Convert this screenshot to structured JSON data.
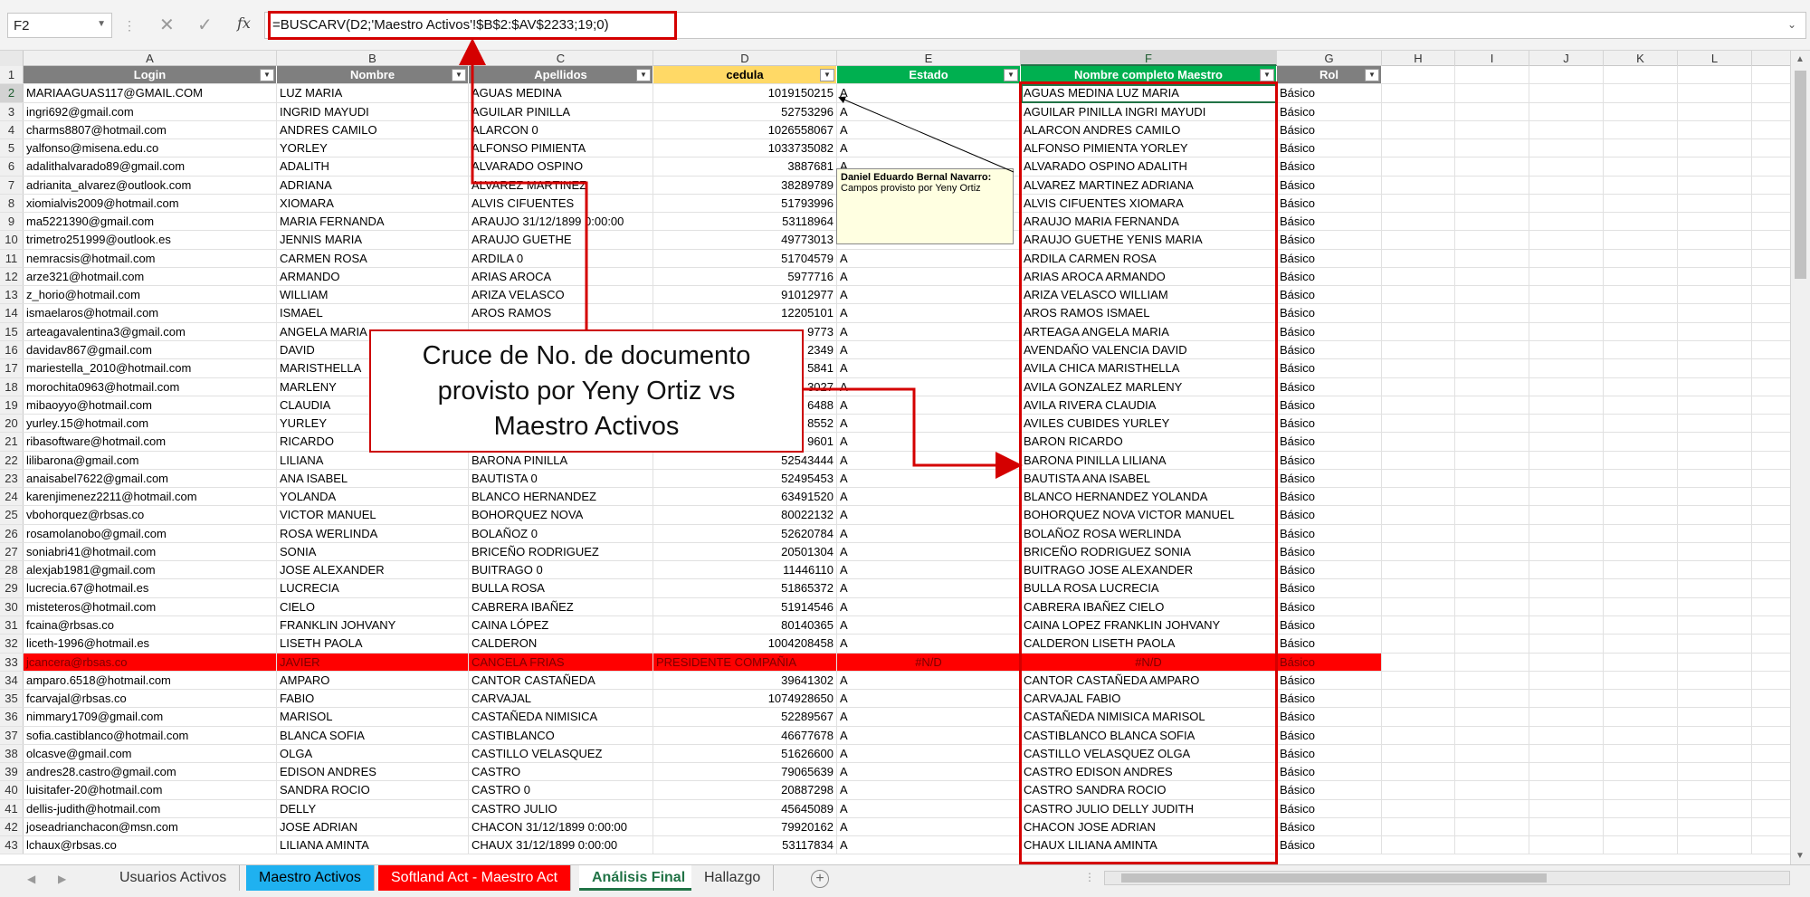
{
  "formula_bar": {
    "name_box": "F2",
    "formula": "=BUSCARV(D2;'Maestro Activos'!$B$2:$AV$2233;19;0)",
    "fx_label": "fx"
  },
  "columns": [
    "A",
    "B",
    "C",
    "D",
    "E",
    "F",
    "G",
    "H",
    "I",
    "J",
    "K",
    "L"
  ],
  "headers": {
    "login": "Login",
    "nombre": "Nombre",
    "apellidos": "Apellidos",
    "cedula": "cedula",
    "estado": "Estado",
    "nombre_completo": "Nombre completo Maestro",
    "rol": "Rol"
  },
  "rows": [
    {
      "n": "2",
      "login": "MARIAAGUAS117@GMAIL.COM",
      "nombre": "LUZ MARIA",
      "apellidos": "AGUAS MEDINA",
      "cedula": "1019150215",
      "estado": "A",
      "maestro": "AGUAS MEDINA LUZ  MARIA",
      "rol": "Básico"
    },
    {
      "n": "3",
      "login": "ingri692@gmail.com",
      "nombre": "INGRID MAYUDI",
      "apellidos": "AGUILAR PINILLA",
      "cedula": "52753296",
      "estado": "A",
      "maestro": "AGUILAR PINILLA INGRI  MAYUDI",
      "rol": "Básico"
    },
    {
      "n": "4",
      "login": "charms8807@hotmail.com",
      "nombre": "ANDRES CAMILO",
      "apellidos": "ALARCON 0",
      "cedula": "1026558067",
      "estado": "A",
      "maestro": "ALARCON  ANDRES CAMILO",
      "rol": "Básico"
    },
    {
      "n": "5",
      "login": "yalfonso@misena.edu.co",
      "nombre": "YORLEY",
      "apellidos": "ALFONSO PIMIENTA",
      "cedula": "1033735082",
      "estado": "A",
      "maestro": "ALFONSO PIMIENTA YORLEY",
      "rol": "Básico"
    },
    {
      "n": "6",
      "login": "adalithalvarado89@gmail.com",
      "nombre": "ADALITH",
      "apellidos": "ALVARADO OSPINO",
      "cedula": "3887681",
      "estado": "A",
      "maestro": "ALVARADO OSPINO ADALITH",
      "rol": "Básico"
    },
    {
      "n": "7",
      "login": "adrianita_alvarez@outlook.com",
      "nombre": "ADRIANA",
      "apellidos": "ALVAREZ MARTINEZ",
      "cedula": "38289789",
      "estado": "A",
      "maestro": "ALVAREZ MARTINEZ ADRIANA",
      "rol": "Básico"
    },
    {
      "n": "8",
      "login": "xiomialvis2009@hotmail.com",
      "nombre": "XIOMARA",
      "apellidos": "ALVIS CIFUENTES",
      "cedula": "51793996",
      "estado": "A",
      "maestro": "ALVIS CIFUENTES XIOMARA",
      "rol": "Básico"
    },
    {
      "n": "9",
      "login": "ma5221390@gmail.com",
      "nombre": "MARIA FERNANDA",
      "apellidos": "ARAUJO 31/12/1899 0:00:00",
      "cedula": "53118964",
      "estado": "A",
      "maestro": "ARAUJO   MARIA FERNANDA",
      "rol": "Básico"
    },
    {
      "n": "10",
      "login": "trimetro251999@outlook.es",
      "nombre": "JENNIS  MARIA",
      "apellidos": "ARAUJO GUETHE",
      "cedula": "49773013",
      "estado": "A",
      "maestro": "ARAUJO GUETHE YENIS  MARIA",
      "rol": "Básico"
    },
    {
      "n": "11",
      "login": "nemracsis@hotmail.com",
      "nombre": "CARMEN ROSA",
      "apellidos": "ARDILA 0",
      "cedula": "51704579",
      "estado": "A",
      "maestro": "ARDILA   CARMEN ROSA",
      "rol": "Básico"
    },
    {
      "n": "12",
      "login": "arze321@hotmail.com",
      "nombre": "ARMANDO",
      "apellidos": "ARIAS AROCA",
      "cedula": "5977716",
      "estado": "A",
      "maestro": "ARIAS AROCA ARMANDO",
      "rol": "Básico"
    },
    {
      "n": "13",
      "login": "z_horio@hotmail.com",
      "nombre": "WILLIAM",
      "apellidos": "ARIZA VELASCO",
      "cedula": "91012977",
      "estado": "A",
      "maestro": "ARIZA VELASCO WILLIAM",
      "rol": "Básico"
    },
    {
      "n": "14",
      "login": "ismaelaros@hotmail.com",
      "nombre": "ISMAEL",
      "apellidos": "AROS RAMOS",
      "cedula": "12205101",
      "estado": "A",
      "maestro": "AROS RAMOS ISMAEL",
      "rol": "Básico"
    },
    {
      "n": "15",
      "login": "arteagavalentina3@gmail.com",
      "nombre": "ANGELA MARIA",
      "apellidos": "",
      "cedula": "9773",
      "estado": "A",
      "maestro": "ARTEAGA   ANGELA MARIA",
      "rol": "Básico"
    },
    {
      "n": "16",
      "login": "davidav867@gmail.com",
      "nombre": "DAVID",
      "apellidos": "",
      "cedula": "2349",
      "estado": "A",
      "maestro": "AVENDAÑO VALENCIA DAVID",
      "rol": "Básico"
    },
    {
      "n": "17",
      "login": "mariestella_2010@hotmail.com",
      "nombre": "MARISTHELLA",
      "apellidos": "",
      "cedula": "5841",
      "estado": "A",
      "maestro": "AVILA CHICA MARISTHELLA",
      "rol": "Básico"
    },
    {
      "n": "18",
      "login": "morochita0963@hotmail.com",
      "nombre": "MARLENY",
      "apellidos": "",
      "cedula": "3027",
      "estado": "A",
      "maestro": "AVILA GONZALEZ MARLENY",
      "rol": "Básico"
    },
    {
      "n": "19",
      "login": "mibaoyyo@hotmail.com",
      "nombre": "CLAUDIA",
      "apellidos": "",
      "cedula": "6488",
      "estado": "A",
      "maestro": "AVILA RIVERA CLAUDIA",
      "rol": "Básico"
    },
    {
      "n": "20",
      "login": "yurley.15@hotmail.com",
      "nombre": "YURLEY",
      "apellidos": "",
      "cedula": "8552",
      "estado": "A",
      "maestro": "AVILES CUBIDES YURLEY",
      "rol": "Básico"
    },
    {
      "n": "21",
      "login": "ribasoftware@hotmail.com",
      "nombre": "RICARDO",
      "apellidos": "",
      "cedula": "9601",
      "estado": "A",
      "maestro": "BARON   RICARDO",
      "rol": "Básico"
    },
    {
      "n": "22",
      "login": "lilibarona@gmail.com",
      "nombre": "LILIANA",
      "apellidos": "BARONA PINILLA",
      "cedula": "52543444",
      "estado": "A",
      "maestro": "BARONA PINILLA LILIANA",
      "rol": "Básico"
    },
    {
      "n": "23",
      "login": "anaisabel7622@gmail.com",
      "nombre": "ANA ISABEL",
      "apellidos": "BAUTISTA 0",
      "cedula": "52495453",
      "estado": "A",
      "maestro": "BAUTISTA   ANA ISABEL",
      "rol": "Básico"
    },
    {
      "n": "24",
      "login": "karenjimenez2211@hotmail.com",
      "nombre": "YOLANDA",
      "apellidos": "BLANCO HERNANDEZ",
      "cedula": "63491520",
      "estado": "A",
      "maestro": "BLANCO HERNANDEZ YOLANDA",
      "rol": "Básico"
    },
    {
      "n": "25",
      "login": "vbohorquez@rbsas.co",
      "nombre": "VICTOR MANUEL",
      "apellidos": "BOHORQUEZ NOVA",
      "cedula": "80022132",
      "estado": "A",
      "maestro": "BOHORQUEZ NOVA VICTOR  MANUEL",
      "rol": "Básico"
    },
    {
      "n": "26",
      "login": "rosamolanobo@gmail.com",
      "nombre": "ROSA WERLINDA",
      "apellidos": "BOLAÑOZ 0",
      "cedula": "52620784",
      "estado": "A",
      "maestro": "BOLAÑOZ   ROSA WERLINDA",
      "rol": "Básico"
    },
    {
      "n": "27",
      "login": "soniabri41@hotmail.com",
      "nombre": "SONIA",
      "apellidos": "BRICEÑO RODRIGUEZ",
      "cedula": "20501304",
      "estado": "A",
      "maestro": "BRICEÑO RODRIGUEZ SONIA",
      "rol": "Básico"
    },
    {
      "n": "28",
      "login": "alexjab1981@gmail.com",
      "nombre": "JOSE ALEXANDER",
      "apellidos": "BUITRAGO 0",
      "cedula": "11446110",
      "estado": "A",
      "maestro": "BUITRAGO   JOSE ALEXANDER",
      "rol": "Básico"
    },
    {
      "n": "29",
      "login": "lucrecia.67@hotmail.es",
      "nombre": "LUCRECIA",
      "apellidos": "BULLA ROSA",
      "cedula": "51865372",
      "estado": "A",
      "maestro": "BULLA ROSA LUCRECIA",
      "rol": "Básico"
    },
    {
      "n": "30",
      "login": "misteteros@hotmail.com",
      "nombre": "CIELO",
      "apellidos": "CABRERA IBAÑEZ",
      "cedula": "51914546",
      "estado": "A",
      "maestro": "CABRERA IBAÑEZ CIELO",
      "rol": "Básico"
    },
    {
      "n": "31",
      "login": "fcaina@rbsas.co",
      "nombre": "FRANKLIN JOHVANY",
      "apellidos": "CAINA LÓPEZ",
      "cedula": "80140365",
      "estado": "A",
      "maestro": "CAINA LOPEZ FRANKLIN JOHVANY",
      "rol": "Básico"
    },
    {
      "n": "32",
      "login": "liceth-1996@hotmail.es",
      "nombre": "LISETH PAOLA",
      "apellidos": "CALDERON",
      "cedula": "1004208458",
      "estado": "A",
      "maestro": "CALDERON   LISETH PAOLA",
      "rol": "Básico"
    },
    {
      "n": "33",
      "login": "jcancera@rbsas.co",
      "nombre": "JAVIER",
      "apellidos": "CANCELA FRIAS",
      "cedula": "PRESIDENTE COMPAÑIA",
      "estado": "#N/D",
      "maestro": "#N/D",
      "rol": "Básico",
      "error": true
    },
    {
      "n": "34",
      "login": "amparo.6518@hotmail.com",
      "nombre": "AMPARO",
      "apellidos": "CANTOR CASTAÑEDA",
      "cedula": "39641302",
      "estado": "A",
      "maestro": "CANTOR CASTAÑEDA AMPARO",
      "rol": "Básico"
    },
    {
      "n": "35",
      "login": "fcarvajal@rbsas.co",
      "nombre": "FABIO",
      "apellidos": "CARVAJAL",
      "cedula": "1074928650",
      "estado": "A",
      "maestro": "CARVAJAL   FABIO",
      "rol": "Básico"
    },
    {
      "n": "36",
      "login": "nimmary1709@gmail.com",
      "nombre": "MARISOL",
      "apellidos": "CASTAÑEDA NIMISICA",
      "cedula": "52289567",
      "estado": "A",
      "maestro": "CASTAÑEDA NIMISICA MARISOL",
      "rol": "Básico"
    },
    {
      "n": "37",
      "login": "sofia.castiblanco@hotmail.com",
      "nombre": "BLANCA SOFIA",
      "apellidos": "CASTIBLANCO",
      "cedula": "46677678",
      "estado": "A",
      "maestro": "CASTIBLANCO   BLANCA SOFIA",
      "rol": "Básico"
    },
    {
      "n": "38",
      "login": "olcasve@gmail.com",
      "nombre": "OLGA",
      "apellidos": "CASTILLO VELASQUEZ",
      "cedula": "51626600",
      "estado": "A",
      "maestro": "CASTILLO VELASQUEZ OLGA",
      "rol": "Básico"
    },
    {
      "n": "39",
      "login": "andres28.castro@gmail.com",
      "nombre": "EDISON ANDRES",
      "apellidos": "CASTRO",
      "cedula": "79065639",
      "estado": "A",
      "maestro": "CASTRO   EDISON ANDRES",
      "rol": "Básico"
    },
    {
      "n": "40",
      "login": "luisitafer-20@hotmail.com",
      "nombre": "SANDRA ROCIO",
      "apellidos": "CASTRO 0",
      "cedula": "20887298",
      "estado": "A",
      "maestro": "CASTRO   SANDRA ROCIO",
      "rol": "Básico"
    },
    {
      "n": "41",
      "login": "dellis-judith@hotmail.com",
      "nombre": "DELLY",
      "apellidos": "CASTRO JULIO",
      "cedula": "45645089",
      "estado": "A",
      "maestro": "CASTRO JULIO DELLY  JUDITH",
      "rol": "Básico"
    },
    {
      "n": "42",
      "login": "joseadrianchacon@msn.com",
      "nombre": "JOSE ADRIAN",
      "apellidos": "CHACON 31/12/1899 0:00:00",
      "cedula": "79920162",
      "estado": "A",
      "maestro": "CHACON   JOSE ADRIAN",
      "rol": "Básico"
    },
    {
      "n": "43",
      "login": "lchaux@rbsas.co",
      "nombre": "LILIANA AMINTA",
      "apellidos": "CHAUX 31/12/1899 0:00:00",
      "cedula": "53117834",
      "estado": "A",
      "maestro": "CHAUX   LILIANA AMINTA",
      "rol": "Básico"
    }
  ],
  "comment": {
    "author": "Daniel Eduardo Bernal Navarro:",
    "text": "Campos provisto por Yeny Ortiz"
  },
  "callout": {
    "line1": "Cruce de No. de documento",
    "line2": "provisto por Yeny Ortiz vs",
    "line3": "Maestro Activos"
  },
  "sheet_tabs": [
    {
      "label": "Usuarios Activos",
      "color": "#f0f0f0",
      "text": "#333"
    },
    {
      "label": "Maestro Activos",
      "color": "#1fb1f0",
      "text": "#000"
    },
    {
      "label": "Softland Act - Maestro Act",
      "color": "#ff0000",
      "text": "#fff"
    },
    {
      "label": "Análisis Final",
      "color": "#fff",
      "text": "#217346",
      "active": true
    },
    {
      "label": "Hallazgo",
      "color": "#f0f0f0",
      "text": "#333"
    }
  ],
  "colors": {
    "accent": "#217346",
    "highlight": "#d40000",
    "error_row": "#ff0000",
    "cedula_header": "#ffd966",
    "status_header": "#00b050"
  }
}
